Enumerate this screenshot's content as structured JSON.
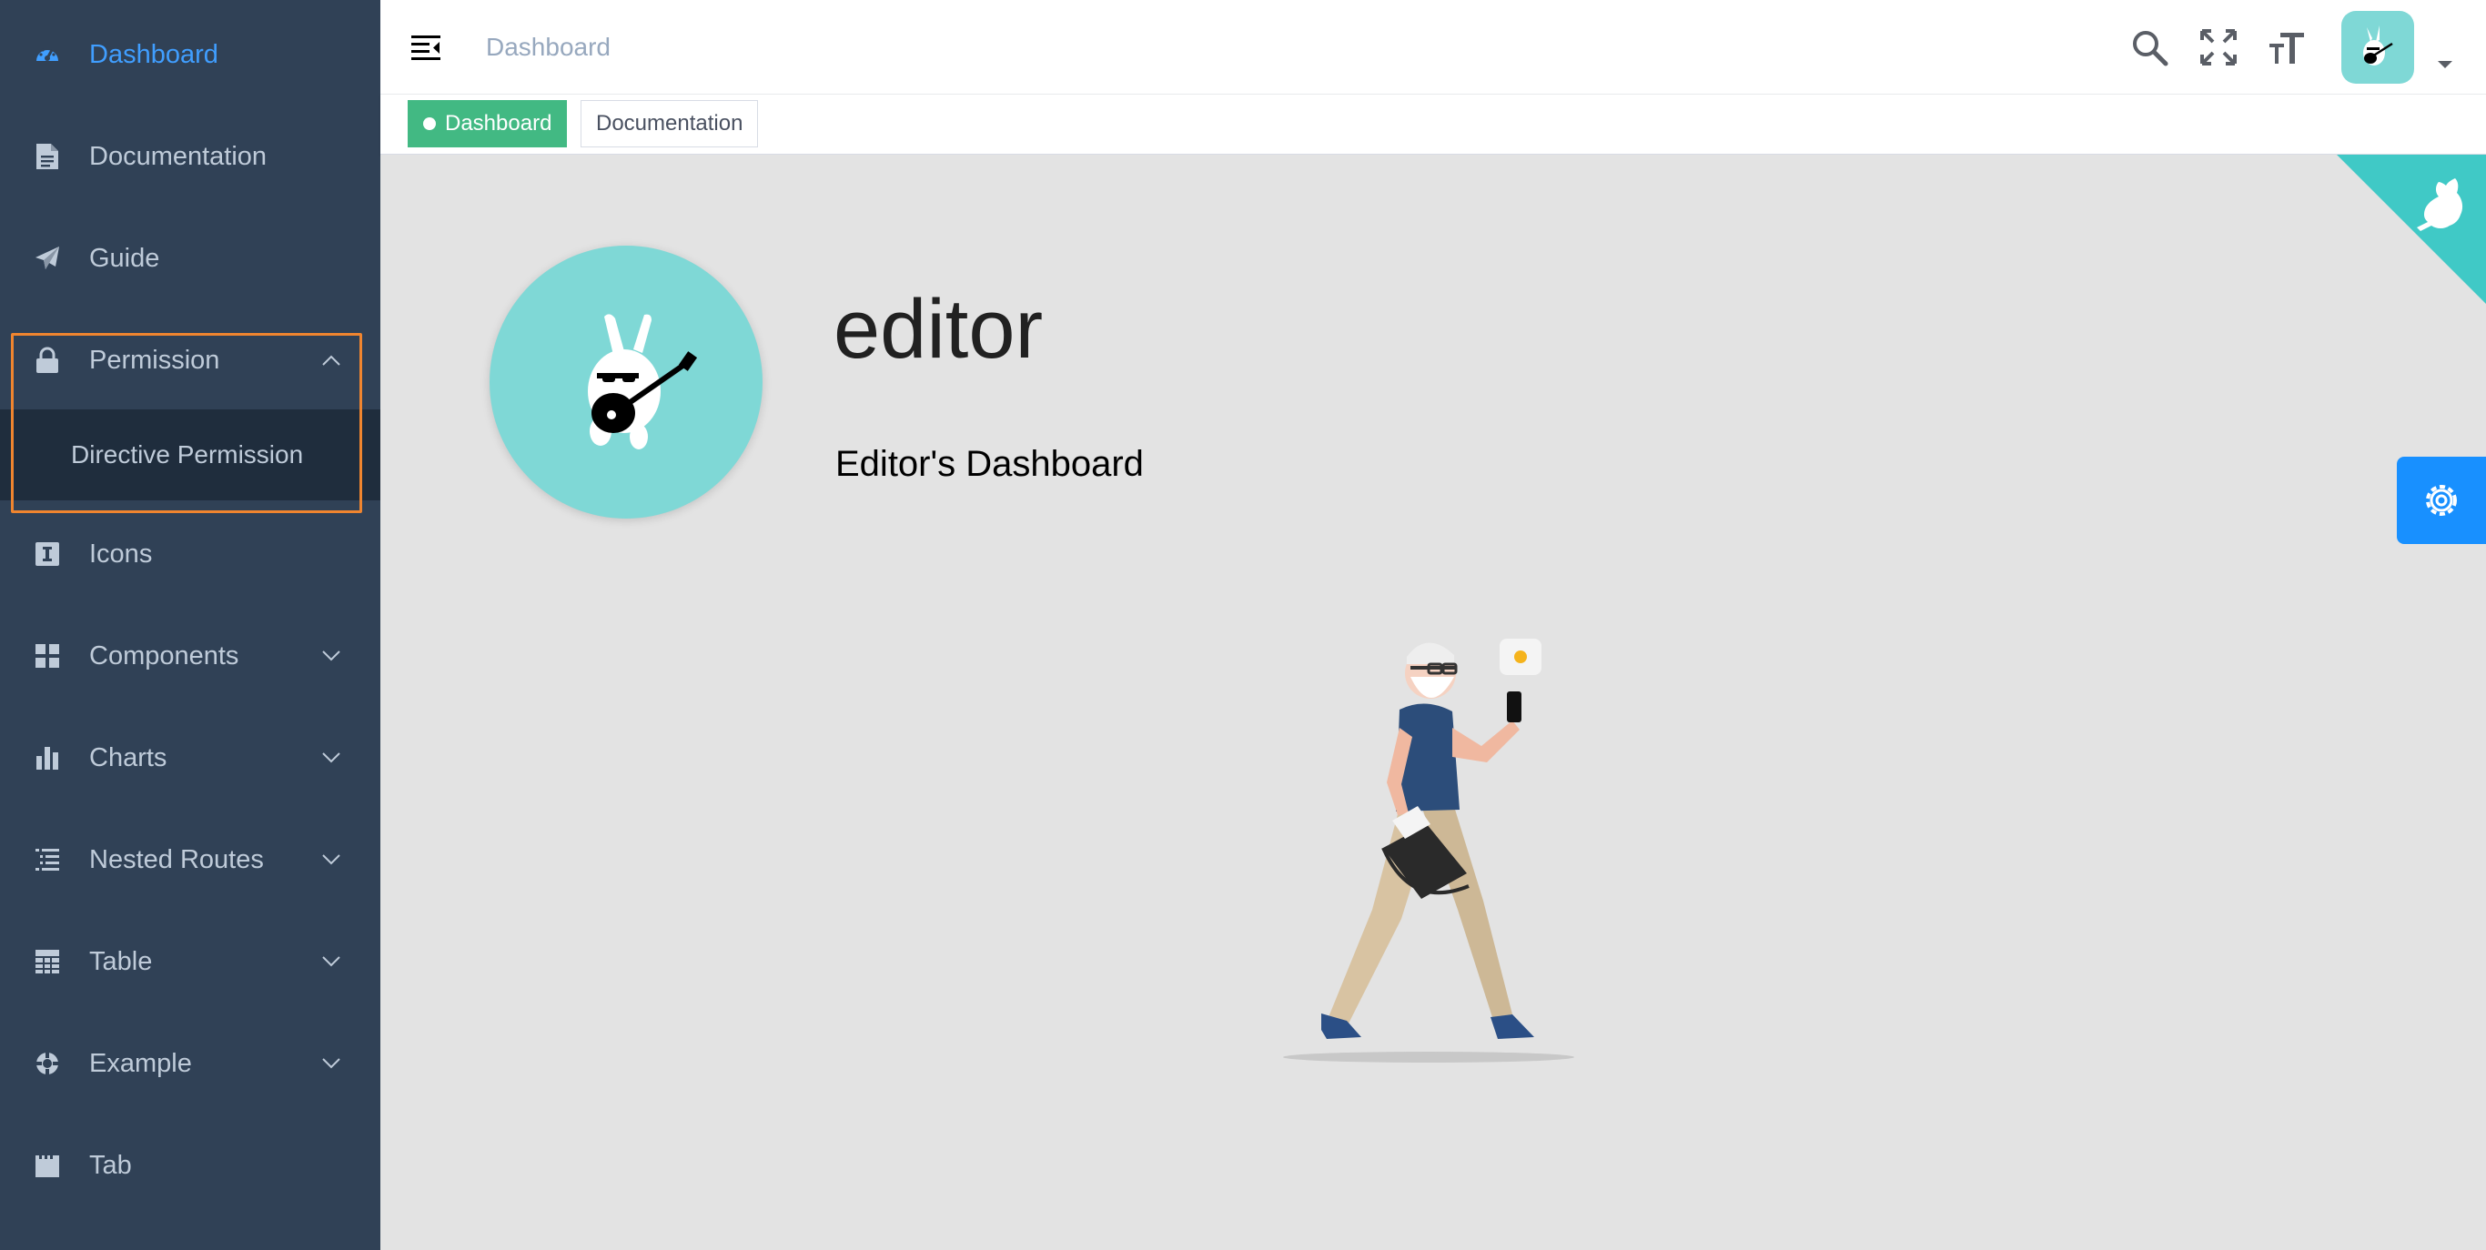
{
  "sidebar": {
    "items": [
      {
        "label": "Dashboard",
        "icon": "dashboard-icon",
        "active": true
      },
      {
        "label": "Documentation",
        "icon": "document-icon"
      },
      {
        "label": "Guide",
        "icon": "paper-plane-icon"
      },
      {
        "label": "Permission",
        "icon": "lock-icon",
        "expanded": true
      },
      {
        "label": "Icons",
        "icon": "icon-icon"
      },
      {
        "label": "Components",
        "icon": "components-icon"
      },
      {
        "label": "Charts",
        "icon": "chart-icon"
      },
      {
        "label": "Nested Routes",
        "icon": "nested-icon"
      },
      {
        "label": "Table",
        "icon": "table-icon"
      },
      {
        "label": "Example",
        "icon": "example-icon"
      },
      {
        "label": "Tab",
        "icon": "tab-icon"
      }
    ],
    "submenu": [
      {
        "label": "Directive Permission"
      }
    ]
  },
  "navbar": {
    "breadcrumb": "Dashboard"
  },
  "tags": [
    {
      "label": "Dashboard",
      "active": true
    },
    {
      "label": "Documentation"
    }
  ],
  "main": {
    "username": "editor",
    "role": "Editor's Dashboard"
  },
  "colors": {
    "sidebar_bg": "#304156",
    "sidebar_text": "#bfcbd9",
    "active": "#409eff",
    "tag_active": "#42b983",
    "avatar_bg": "#7fd8d6",
    "highlight": "#f0852f"
  }
}
